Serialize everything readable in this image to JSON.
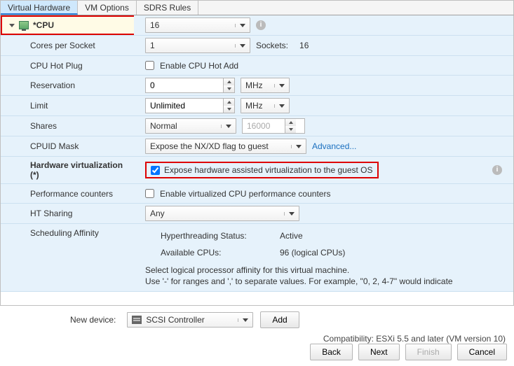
{
  "tabs": {
    "virtual_hardware": "Virtual Hardware",
    "vm_options": "VM Options",
    "sdrs_rules": "SDRS Rules"
  },
  "cpu": {
    "label": "*CPU",
    "value": "16",
    "sockets_label": "Sockets:",
    "sockets_value": "16",
    "cores_label": "Cores per Socket",
    "cores_value": "1",
    "hotplug_label": "CPU Hot Plug",
    "hotplug_checkbox_label": "Enable CPU Hot Add",
    "reservation_label": "Reservation",
    "reservation_value": "0",
    "reservation_unit": "MHz",
    "limit_label": "Limit",
    "limit_value": "Unlimited",
    "limit_unit": "MHz",
    "shares_label": "Shares",
    "shares_value": "Normal",
    "shares_number": "16000",
    "cpuid_label": "CPUID Mask",
    "cpuid_value": "Expose the NX/XD flag to guest",
    "cpuid_advanced": "Advanced...",
    "hwvirt_label": "Hardware virtualization (*)",
    "hwvirt_checkbox_label": "Expose hardware assisted virtualization to the guest OS",
    "perfcnt_label": "Performance counters",
    "perfcnt_checkbox_label": "Enable virtualized CPU performance counters",
    "ht_label": "HT Sharing",
    "ht_value": "Any",
    "affinity_label": "Scheduling Affinity",
    "hyperthread_status_label": "Hyperthreading Status:",
    "hyperthread_status_value": "Active",
    "available_cpus_label": "Available CPUs:",
    "available_cpus_value": "96 (logical CPUs)",
    "affinity_note_1": "Select logical processor affinity for this virtual machine.",
    "affinity_note_2": "Use '-' for ranges and ',' to separate values. For example,  \"0, 2, 4-7\" would indicate"
  },
  "newdevice": {
    "label": "New device:",
    "value": "SCSI Controller",
    "add_label": "Add"
  },
  "compat": {
    "text": "Compatibility: ESXi 5.5 and later (VM version 10)"
  },
  "wizard": {
    "back": "Back",
    "next": "Next",
    "finish": "Finish",
    "cancel": "Cancel"
  }
}
